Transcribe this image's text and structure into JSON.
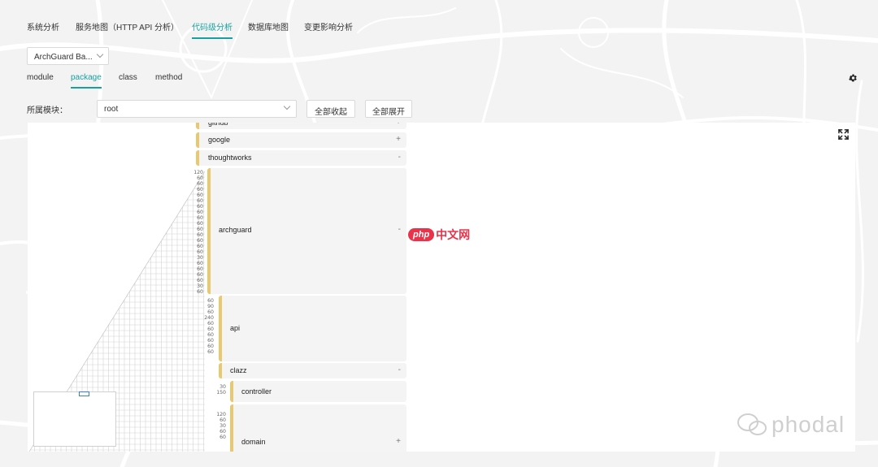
{
  "top_nav": {
    "items": [
      "系统分析",
      "服务地图（HTTP API 分析）",
      "代码级分析",
      "数据库地图",
      "变更影响分析"
    ],
    "active": "代码级分析"
  },
  "system_select": {
    "value": "ArchGuard Ba..."
  },
  "sub_tabs": {
    "items": [
      "module",
      "package",
      "class",
      "method"
    ],
    "active": "package"
  },
  "filter": {
    "module_label": "所属模块：",
    "module_value": "root",
    "collapse_all": "全部收起",
    "expand_all": "全部展开"
  },
  "tree": {
    "nodes": [
      {
        "name": "github",
        "toggle": "+"
      },
      {
        "name": "google",
        "toggle": "+"
      },
      {
        "name": "thoughtworks",
        "toggle": "-"
      },
      {
        "name": "archguard",
        "toggle": "-"
      },
      {
        "name": "api",
        "toggle": ""
      },
      {
        "name": "clazz",
        "toggle": "-"
      },
      {
        "name": "controller",
        "toggle": ""
      },
      {
        "name": "domain",
        "toggle": "+"
      }
    ],
    "dependency_counts": {
      "archguard": [
        "120",
        "60",
        "60",
        "60",
        "60",
        "60",
        "60",
        "60",
        "60",
        "60",
        "60",
        "60",
        "60",
        "60",
        "60",
        "30",
        "60",
        "60",
        "60",
        "60",
        "30",
        "60"
      ],
      "api": [
        "60",
        "90",
        "60",
        "240",
        "60",
        "60",
        "60",
        "60",
        "60",
        "60"
      ],
      "controller": [
        "30",
        "150"
      ],
      "domain": [
        "120",
        "60",
        "30",
        "60",
        "60"
      ]
    }
  },
  "watermarks": {
    "mid_badge": "php",
    "mid_text": "中文网",
    "corner": "phodal"
  },
  "colors": {
    "accent": "#18a0a0",
    "node_bar": "#eac86f",
    "minimap_view": "#3b7ddd"
  },
  "icons": {
    "settings": "gear-icon",
    "fullscreen": "expand-icon",
    "dropdown": "chevron-down-icon"
  }
}
